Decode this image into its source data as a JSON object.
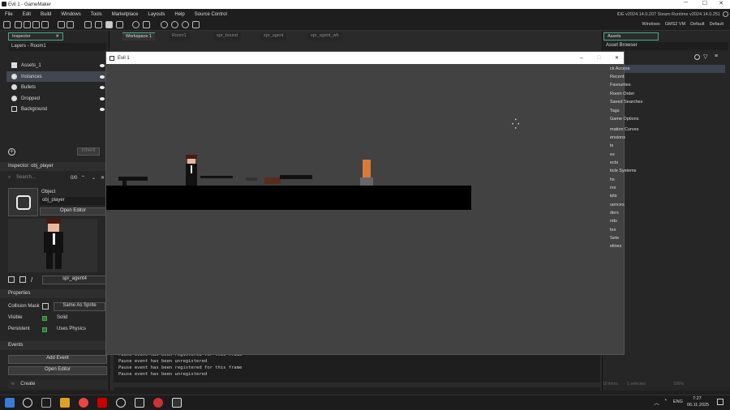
{
  "window": {
    "title": "Evil 1 - GameMaker"
  },
  "menu": {
    "items": [
      "File",
      "Edit",
      "Build",
      "Windows",
      "Tools",
      "Marketplace",
      "Layouts",
      "Help",
      "Source Control"
    ],
    "version": "IDE v2024.14.0.207 Steam  Runtime v2024.14.0.251"
  },
  "toolbar": {
    "right_items": [
      "Windows",
      "GMS2 VM",
      "Default",
      "Default"
    ]
  },
  "left": {
    "inspector_tab": "Inspector",
    "layers_header": "Layers - Room1",
    "layers": [
      {
        "name": "Assets_1"
      },
      {
        "name": "Instances"
      },
      {
        "name": "Bullets"
      },
      {
        "name": "Dropped"
      },
      {
        "name": "Background"
      }
    ],
    "inherit_btn": "Inherit",
    "inspector_title": "Inspector: obj_player",
    "search_placeholder": "Search...",
    "counter": "0/0",
    "object_label": "Object",
    "object_name": "obj_player",
    "open_editor": "Open Editor",
    "sprite_name": "spr_agent4",
    "properties_header": "Properties",
    "collision_mask": "Collision Mask",
    "same_as_sprite": "Same As Sprite",
    "visible": "Visible",
    "solid": "Solid",
    "persistent": "Persistent",
    "uses_physics": "Uses Physics",
    "events_header": "Events",
    "add_event": "Add Event",
    "open_editor2": "Open Editor",
    "create_event": "Create"
  },
  "workspace": {
    "tabs": [
      "Workspace 1",
      "Room1",
      "spr_bound",
      "spr_agent",
      "spr_agent_wh"
    ]
  },
  "game": {
    "title": "Evil 1"
  },
  "output": {
    "lines": [
      "Pause event has been registered for this frame",
      "Pause event has been unregistered",
      "Pause event has been registered for this frame",
      "Pause event has been unregistered"
    ]
  },
  "right": {
    "assets_tab": "Assets",
    "asset_browser": "Asset Browser",
    "items": [
      "ck Access",
      "Recent",
      "Favourites",
      "Room Order",
      "Saved Searches",
      "Tags",
      "Game Options",
      "mation Curves",
      "ensions",
      "ts",
      "es",
      "ects",
      "ticle Systems",
      "hs",
      "ms",
      "ipts",
      "uences",
      "ders",
      "nds",
      "tes",
      "Sets",
      "elines"
    ],
    "footer_items": "10 items",
    "footer_selected": "1 selected",
    "zoom": "100%"
  },
  "taskbar": {
    "lang": "ENG",
    "time": "7:27",
    "date": "06.11.2025"
  }
}
